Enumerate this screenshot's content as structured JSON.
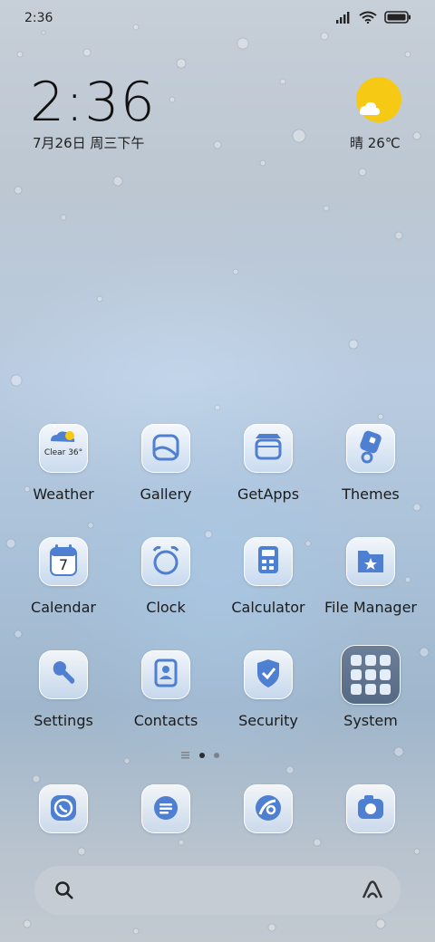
{
  "status_bar": {
    "time": "2:36"
  },
  "widget": {
    "clock": "2:36",
    "date": "7月26日 周三下午",
    "weather": "晴 26℃"
  },
  "apps": [
    {
      "label": "Weather",
      "badge": "Clear 36°"
    },
    {
      "label": "Gallery"
    },
    {
      "label": "GetApps"
    },
    {
      "label": "Themes"
    },
    {
      "label": "Calendar",
      "badge": "7"
    },
    {
      "label": "Clock"
    },
    {
      "label": "Calculator"
    },
    {
      "label": "File Manager"
    },
    {
      "label": "Settings"
    },
    {
      "label": "Contacts"
    },
    {
      "label": "Security"
    },
    {
      "label": "System"
    }
  ],
  "dock": [
    "whatsapp-icon",
    "messages-icon",
    "browser-icon",
    "camera-icon"
  ],
  "colors": {
    "accent": "#4f7fd0",
    "sun": "#f6c915"
  }
}
